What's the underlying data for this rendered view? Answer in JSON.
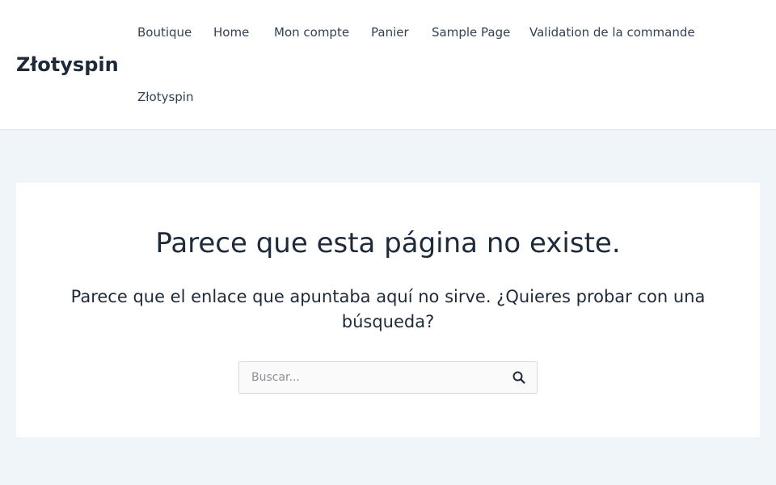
{
  "header": {
    "site_title": "Złotyspin",
    "nav": [
      {
        "label": "Boutique"
      },
      {
        "label": "Home"
      },
      {
        "label": "Mon compte"
      },
      {
        "label": "Panier"
      },
      {
        "label": "Sample Page"
      },
      {
        "label": "Validation de la commande"
      },
      {
        "label": "Złotyspin"
      }
    ]
  },
  "main": {
    "title": "Parece que esta página no existe.",
    "subtitle": "Parece que el enlace que apuntaba aquí no sirve. ¿Quieres probar con una búsqueda?",
    "search": {
      "placeholder": "Buscar...",
      "icon": "search-icon"
    }
  },
  "colors": {
    "page_background": "#f0f5fa",
    "text": "#1e2a3a"
  }
}
